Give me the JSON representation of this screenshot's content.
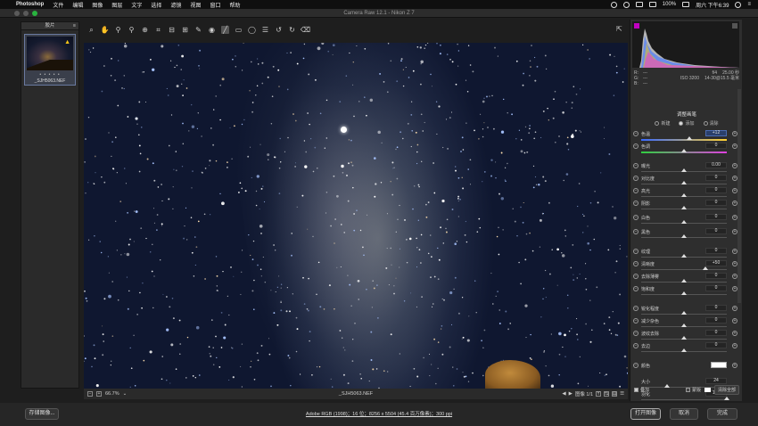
{
  "menubar": {
    "app": "Photoshop",
    "items": [
      "文件",
      "编辑",
      "图像",
      "图层",
      "文字",
      "选择",
      "滤镜",
      "视图",
      "窗口",
      "帮助"
    ],
    "battery": "100%",
    "clock": "周六 下午6:39"
  },
  "window": {
    "title": "Camera Raw 12.1 - Nikon Z 7"
  },
  "filmstrip": {
    "header": "胶片",
    "thumb_name": "_SJH5063.NEF",
    "rating": "• • • • •"
  },
  "toolbar": {
    "tools": [
      "zoom-tool-icon",
      "hand-tool-icon",
      "white-balance-icon",
      "color-sampler-icon",
      "targeted-adjust-icon",
      "crop-icon",
      "straighten-icon",
      "transform-icon",
      "spot-removal-icon",
      "red-eye-icon",
      "adjustment-brush-icon",
      "graduated-filter-icon",
      "radial-filter-icon",
      "preferences-icon",
      "rotate-left-icon",
      "rotate-right-icon",
      "trash-icon"
    ]
  },
  "status": {
    "zoom": "66.7%",
    "filename": "_SJH5063.NEF",
    "image_count": "图像 1/1"
  },
  "histogram": {
    "r": "R:",
    "g": "G:",
    "b": "B:",
    "r_val": "---",
    "g_val": "---",
    "b_val": "---",
    "aperture": "f/4",
    "shutter": "25.00 秒",
    "iso": "ISO 3200",
    "lens": "14-30@15.5 毫米"
  },
  "panel": {
    "title": "调整画笔",
    "modes": [
      "新建",
      "添加",
      "清除"
    ],
    "sliders": [
      {
        "label": "色温",
        "value": "+12",
        "pos": 0.56
      },
      {
        "label": "色调",
        "value": "0",
        "pos": 0.5
      },
      {
        "label": "曝光",
        "value": "0.00",
        "pos": 0.5
      },
      {
        "label": "对比度",
        "value": "0",
        "pos": 0.5
      },
      {
        "label": "高光",
        "value": "0",
        "pos": 0.5
      },
      {
        "label": "阴影",
        "value": "0",
        "pos": 0.5
      },
      {
        "label": "白色",
        "value": "0",
        "pos": 0.5
      },
      {
        "label": "黑色",
        "value": "0",
        "pos": 0.5
      },
      {
        "label": "纹理",
        "value": "0",
        "pos": 0.5
      },
      {
        "label": "清晰度",
        "value": "+50",
        "pos": 0.75
      },
      {
        "label": "去除薄雾",
        "value": "0",
        "pos": 0.5
      },
      {
        "label": "饱和度",
        "value": "0",
        "pos": 0.5
      },
      {
        "label": "锐化程度",
        "value": "0",
        "pos": 0.5
      },
      {
        "label": "减少杂色",
        "value": "0",
        "pos": 0.5
      },
      {
        "label": "波纹去除",
        "value": "0",
        "pos": 0.5
      },
      {
        "label": "去边",
        "value": "0",
        "pos": 0.5
      },
      {
        "label": "颜色",
        "value": "",
        "pos": null
      },
      {
        "label": "大小",
        "value": "24",
        "pos": 0.3
      },
      {
        "label": "羽化",
        "value": "100",
        "pos": 1.0
      }
    ],
    "overlay": "叠加",
    "mask": "蒙版",
    "clear_all": "清除全部"
  },
  "bottom": {
    "save": "存储图像...",
    "workflow": "Adobe RGB (1998)；16 位；8256 x 5504 (45.4 百万像素)；300 ppi",
    "open": "打开图像",
    "cancel": "取消",
    "done": "完成"
  },
  "colors": {
    "accent": "#4a6ab0",
    "bg": "#2e2e2e"
  }
}
